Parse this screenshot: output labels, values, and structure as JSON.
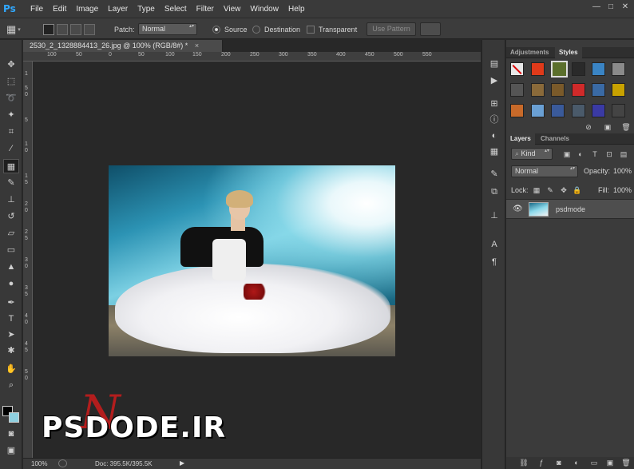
{
  "menubar": {
    "app_logo": "Ps",
    "items": [
      "File",
      "Edit",
      "Image",
      "Layer",
      "Type",
      "Select",
      "Filter",
      "View",
      "Window",
      "Help"
    ],
    "window_controls": [
      "—",
      "□",
      "✕"
    ]
  },
  "options": {
    "patch_label": "Patch:",
    "patch_mode": "Normal",
    "source_label": "Source",
    "destination_label": "Destination",
    "transparent_label": "Transparent",
    "use_pattern_label": "Use Pattern"
  },
  "document": {
    "tab_title": "2530_2_1328884413_26.jpg @ 100% (RGB/8#) *",
    "tab_close": "×",
    "ruler_h": [
      "100",
      "50",
      "0",
      "50",
      "100",
      "150",
      "200",
      "250",
      "300",
      "350",
      "400",
      "450",
      "500",
      "550"
    ],
    "ruler_v": [
      "1",
      "5",
      "0",
      "5",
      "1",
      "0",
      "1",
      "5",
      "2",
      "0",
      "2",
      "5",
      "3",
      "0",
      "3",
      "5",
      "4",
      "0",
      "4",
      "5",
      "5",
      "0"
    ],
    "zoom": "100%",
    "doc_info": "Doc: 395.5K/395.5K"
  },
  "watermark": {
    "text": "PSDODE.IR",
    "overlay_letter": "N"
  },
  "panels": {
    "adjustments_tab": "Adjustments",
    "styles_tab": "Styles",
    "layers_tab": "Layers",
    "channels_tab": "Channels",
    "kind_label": "Kind",
    "blend_mode": "Normal",
    "opacity_label": "Opacity:",
    "opacity_value": "100%",
    "lock_label": "Lock:",
    "fill_label": "Fill:",
    "fill_value": "100%",
    "layer_name": "psdmode"
  },
  "style_swatch_colors": [
    "#e8e8e8",
    "#e03a1a",
    "#5b6f2c",
    "#2a2a2a",
    "#3a84c4",
    "#8a8a8a",
    "#555555",
    "#8a6a3a",
    "#7a5a2a",
    "#d02a2a",
    "#3a6aa4",
    "#c8a200",
    "#c86a2a",
    "#6aa0d4",
    "#3a5a9a",
    "#4a5a6a",
    "#3a3aa4",
    "#444444"
  ]
}
